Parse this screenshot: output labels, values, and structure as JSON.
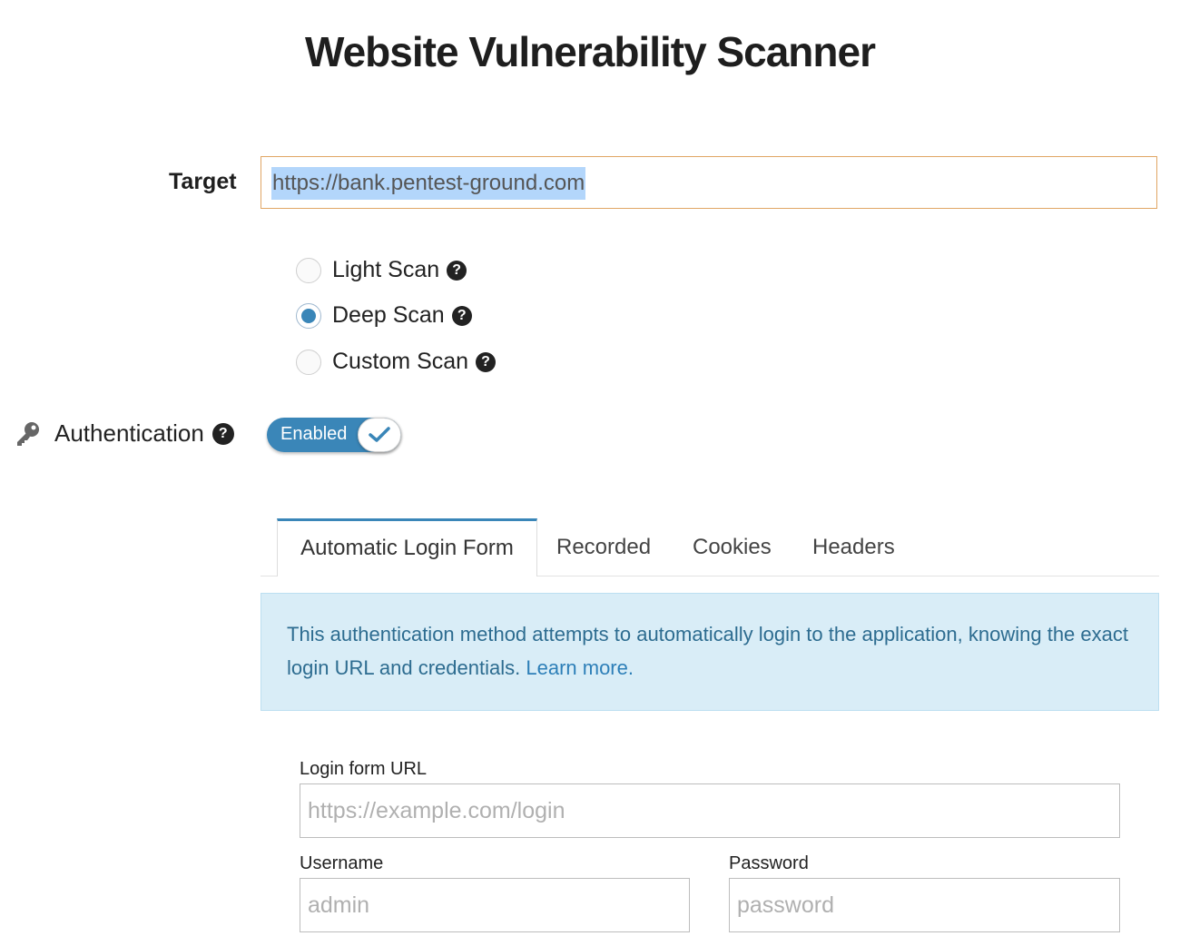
{
  "title": "Website Vulnerability Scanner",
  "target": {
    "label": "Target",
    "value": "https://bank.pentest-ground.com"
  },
  "scan_types": [
    {
      "label": "Light Scan",
      "checked": false
    },
    {
      "label": "Deep Scan",
      "checked": true
    },
    {
      "label": "Custom Scan",
      "checked": false
    }
  ],
  "authentication": {
    "label": "Authentication",
    "toggle_label": "Enabled",
    "enabled": true
  },
  "tabs": [
    {
      "label": "Automatic Login Form",
      "active": true
    },
    {
      "label": "Recorded",
      "active": false
    },
    {
      "label": "Cookies",
      "active": false
    },
    {
      "label": "Headers",
      "active": false
    }
  ],
  "info": {
    "text": "This authentication method attempts to automatically login to the application, knowing the exact login URL and credentials.",
    "link": "Learn more."
  },
  "form": {
    "login_url_label": "Login form URL",
    "login_url_placeholder": "https://example.com/login",
    "username_label": "Username",
    "username_placeholder": "admin",
    "password_label": "Password",
    "password_placeholder": "password"
  },
  "colors": {
    "accent": "#3a86b8",
    "info_bg": "#d9edf7",
    "info_text": "#2d6c90",
    "target_border": "#e1a664",
    "selection": "#b3d6fb"
  },
  "icons": {
    "help": "question-circle-icon",
    "key": "key-icon",
    "check": "check-icon"
  }
}
